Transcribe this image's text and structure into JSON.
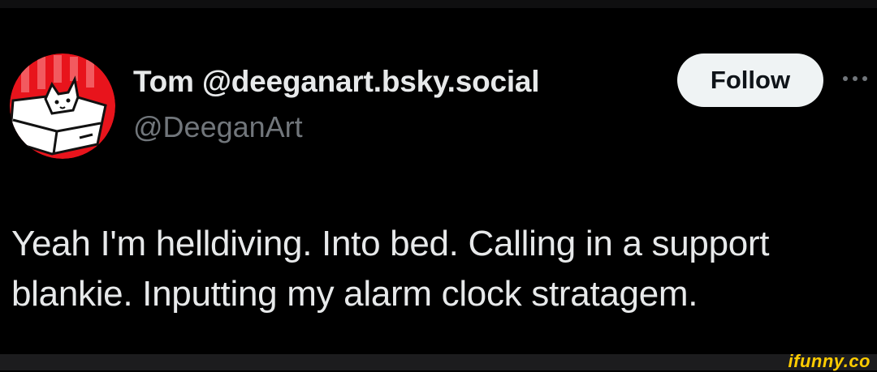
{
  "user": {
    "display_name": "Tom @deeganart.bsky.social",
    "handle": "@DeeganArt",
    "avatar_icon": "cat-in-box-avatar"
  },
  "actions": {
    "follow_label": "Follow",
    "more_icon": "more-horizontal-icon"
  },
  "tweet": {
    "text": "Yeah I'm helldiving. Into bed. Calling in a support\nblankie. Inputting my alarm clock stratagem."
  },
  "watermark": {
    "text": "ifunny.co",
    "color": "#ffcc00"
  },
  "colors": {
    "background": "#000000",
    "text_primary": "#e7e9ea",
    "text_secondary": "#71767b",
    "button_bg": "#eff3f4",
    "avatar_red": "#e8141c"
  }
}
